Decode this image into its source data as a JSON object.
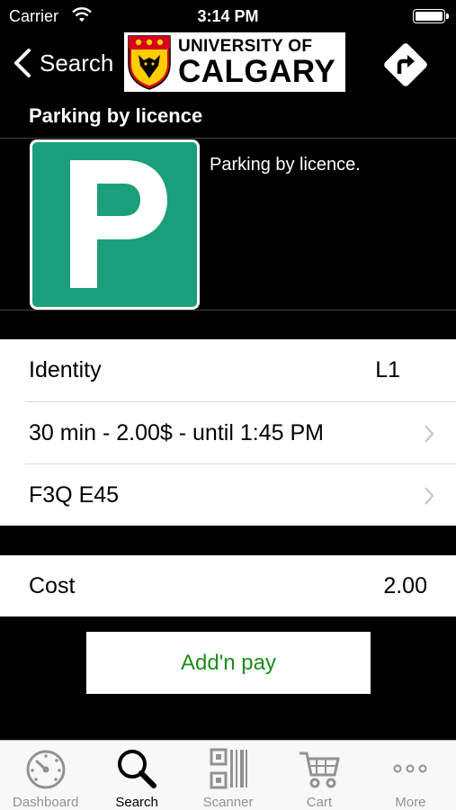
{
  "status_bar": {
    "carrier": "Carrier",
    "time": "3:14 PM"
  },
  "nav": {
    "back_label": "Search",
    "logo": {
      "line1": "UNIVERSITY OF",
      "line2": "CALGARY"
    },
    "action_icon": "directions-icon"
  },
  "header": {
    "title": "Parking by licence"
  },
  "info": {
    "sign_letter": "P",
    "description": "Parking by licence."
  },
  "details": [
    {
      "label": "Identity",
      "value": "L1",
      "disclosure": false
    },
    {
      "label": "30 min - 2.00$ - until 1:45 PM",
      "value": "",
      "disclosure": true
    },
    {
      "label": "F3Q E45",
      "value": "",
      "disclosure": true
    }
  ],
  "cost": {
    "label": "Cost",
    "value": "2.00"
  },
  "pay_button": {
    "label": "Add'n pay"
  },
  "tabs": [
    {
      "label": "Dashboard",
      "icon": "dashboard-gauge-icon",
      "active": false
    },
    {
      "label": "Search",
      "icon": "search-icon",
      "active": true
    },
    {
      "label": "Scanner",
      "icon": "barcode-icon",
      "active": false
    },
    {
      "label": "Cart",
      "icon": "cart-icon",
      "active": false
    },
    {
      "label": "More",
      "icon": "more-icon",
      "active": false
    }
  ],
  "colors": {
    "sign_green": "#1b9e7a",
    "pay_text": "#1a8f1a",
    "tab_inactive": "#929292"
  }
}
